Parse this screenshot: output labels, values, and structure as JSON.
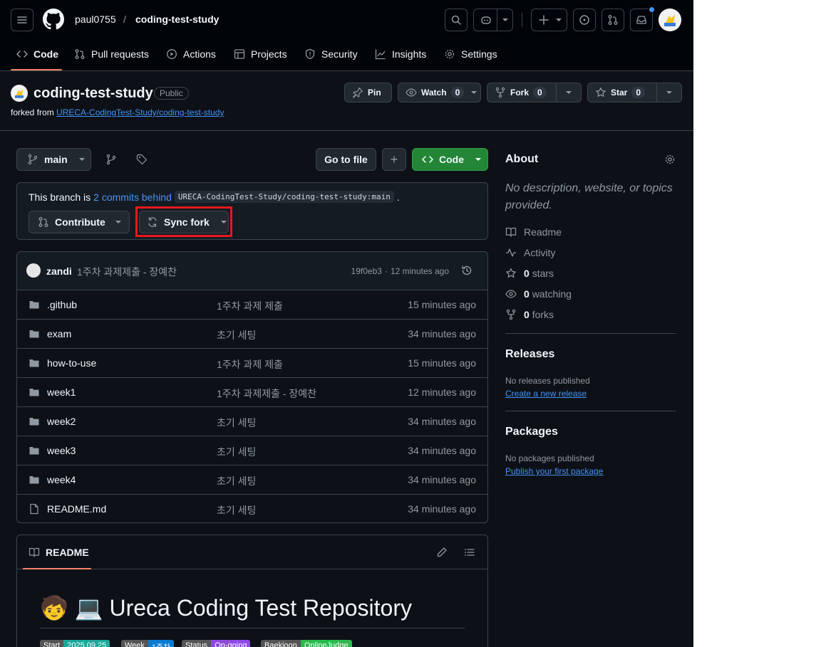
{
  "header": {
    "owner": "paul0755",
    "separator": "/",
    "repo": "coding-test-study",
    "accent": "#f78166"
  },
  "nav": {
    "tabs": [
      {
        "label": "Code",
        "icon": "code-icon",
        "active": true
      },
      {
        "label": "Pull requests",
        "icon": "pull-request-icon"
      },
      {
        "label": "Actions",
        "icon": "play-icon"
      },
      {
        "label": "Projects",
        "icon": "table-icon"
      },
      {
        "label": "Security",
        "icon": "shield-icon"
      },
      {
        "label": "Insights",
        "icon": "graph-icon"
      },
      {
        "label": "Settings",
        "icon": "gear-icon"
      }
    ]
  },
  "repo": {
    "name": "coding-test-study",
    "visibility": "Public",
    "forked_prefix": "forked from",
    "forked_from": "URECA-CodingTest-Study/coding-test-study",
    "pin_label": "Pin",
    "watch_label": "Watch",
    "watch_count": "0",
    "fork_label": "Fork",
    "fork_count": "0",
    "star_label": "Star",
    "star_count": "0"
  },
  "toolbar": {
    "branch": "main",
    "goto_file": "Go to file",
    "add": "+",
    "code": "Code",
    "code_color": "#238636"
  },
  "fork_status": {
    "prefix": "This branch is",
    "behind": "2 commits behind",
    "upstream": "URECA-CodingTest-Study/coding-test-study:main",
    "suffix": ".",
    "contribute": "Contribute",
    "sync_fork": "Sync fork",
    "highlight_color": "#e5191e"
  },
  "commit": {
    "author": "zandi",
    "message": "1주차 과제제출 - 장예찬",
    "hash": "19f0eb3",
    "dot": "·",
    "age": "12 minutes ago"
  },
  "files": [
    {
      "name": ".github",
      "type": "folder",
      "message": "1주차 과제 제출",
      "time": "15 minutes ago"
    },
    {
      "name": "exam",
      "type": "folder",
      "message": "초기 세팅",
      "time": "34 minutes ago"
    },
    {
      "name": "how-to-use",
      "type": "folder",
      "message": "1주차 과제 제출",
      "time": "15 minutes ago"
    },
    {
      "name": "week1",
      "type": "folder",
      "message": "1주차 과제제출 - 장예찬",
      "time": "12 minutes ago"
    },
    {
      "name": "week2",
      "type": "folder",
      "message": "초기 세팅",
      "time": "34 minutes ago"
    },
    {
      "name": "week3",
      "type": "folder",
      "message": "초기 세팅",
      "time": "34 minutes ago"
    },
    {
      "name": "week4",
      "type": "folder",
      "message": "초기 세팅",
      "time": "34 minutes ago"
    },
    {
      "name": "README.md",
      "type": "file",
      "message": "초기 세팅",
      "time": "34 minutes ago"
    }
  ],
  "readme": {
    "tab": "README",
    "title": "🧒 💻 Ureca Coding Test Repository",
    "badges": [
      {
        "label": "Start",
        "value": "2025.09.25",
        "color": "#1ba89a"
      },
      {
        "label": "Week",
        "value": "1주차",
        "color": "#0a7bd1"
      },
      {
        "label": "Status",
        "value": "On-going",
        "color": "#8f4bdc"
      },
      {
        "label": "Baekjoon",
        "value": "OnlineJudge",
        "color": "#2fb84d"
      }
    ]
  },
  "about": {
    "heading": "About",
    "description": "No description, website, or topics provided.",
    "readme": "Readme",
    "activity": "Activity",
    "stars_count": "0",
    "stars_label": "stars",
    "watching_count": "0",
    "watching_label": "watching",
    "forks_count": "0",
    "forks_label": "forks"
  },
  "releases": {
    "heading": "Releases",
    "empty": "No releases published",
    "create": "Create a new release"
  },
  "packages": {
    "heading": "Packages",
    "empty": "No packages published",
    "publish": "Publish your first package"
  }
}
